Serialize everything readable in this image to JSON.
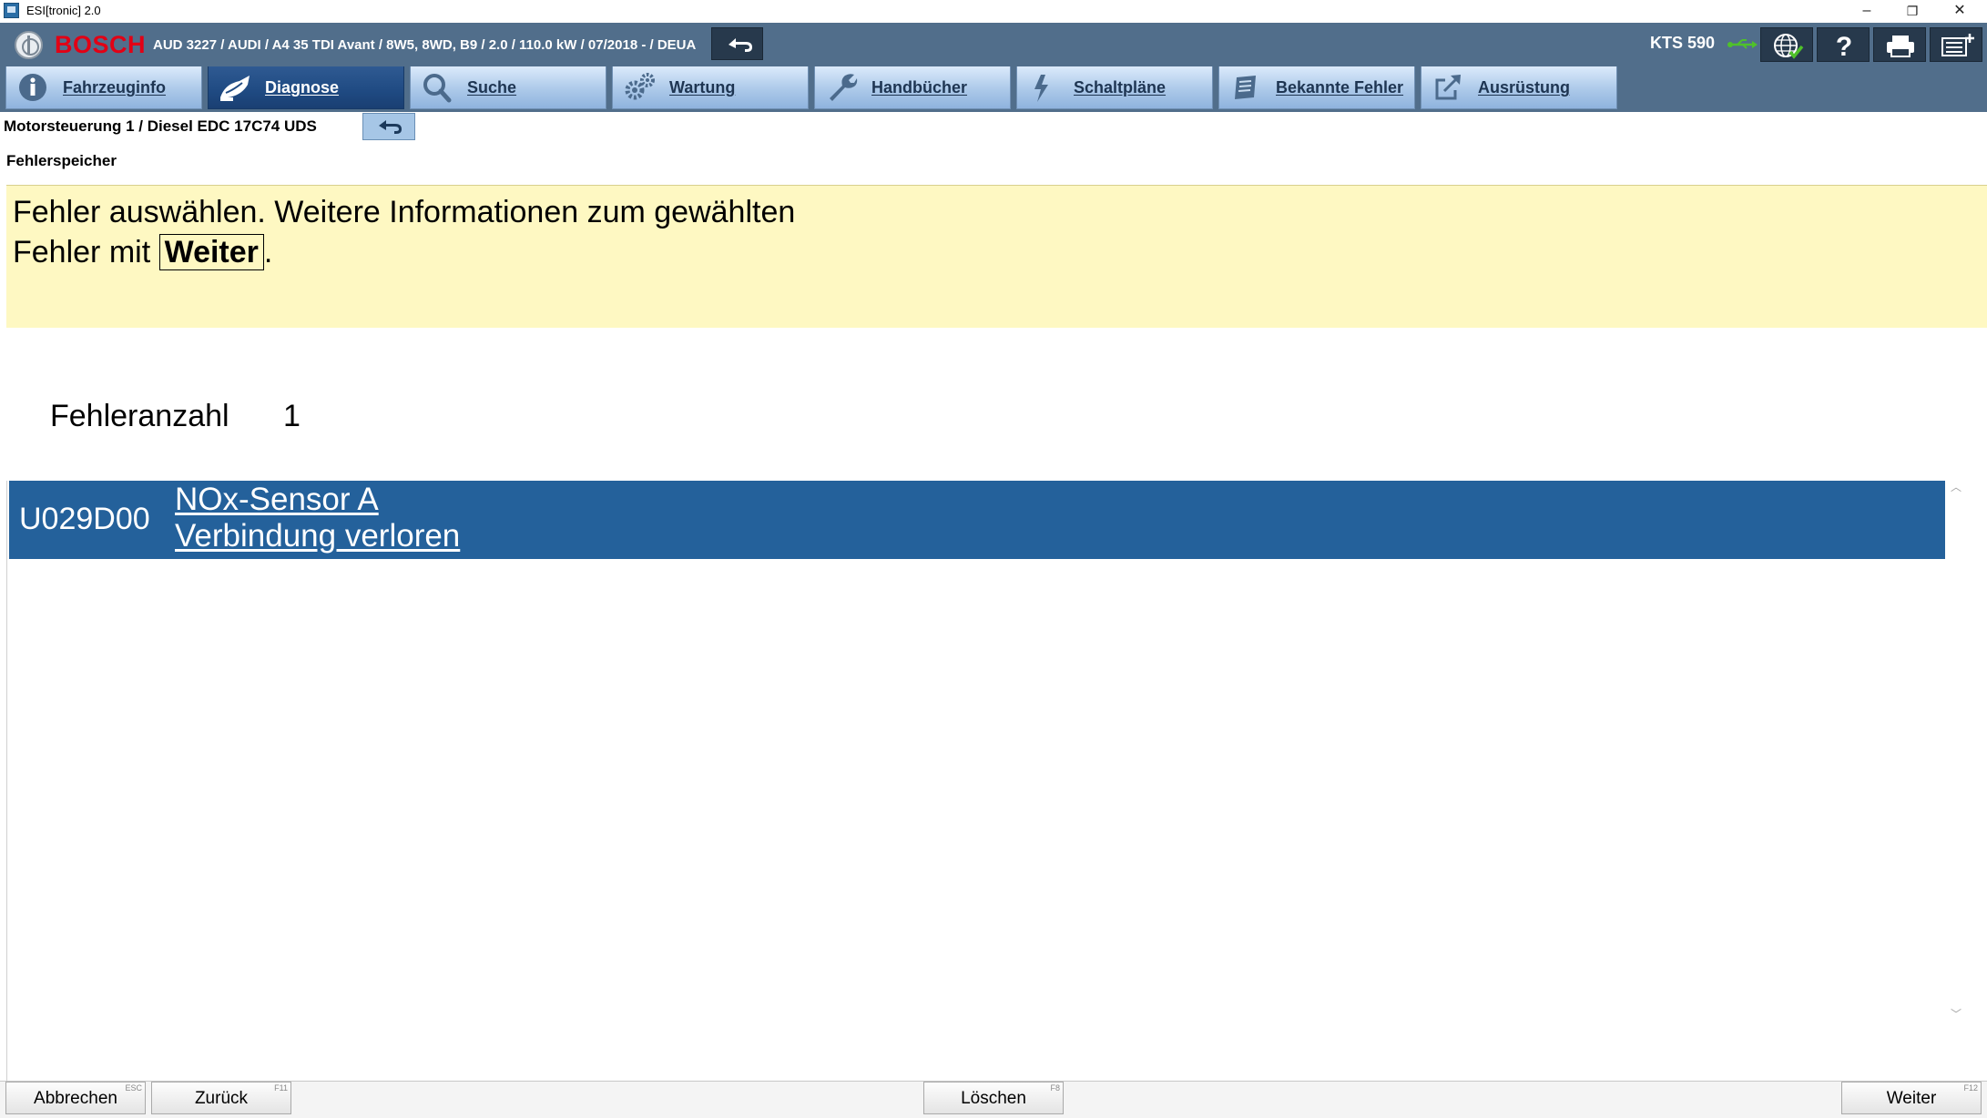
{
  "window": {
    "title": "ESI[tronic] 2.0",
    "minimize_glyph": "–",
    "restore_glyph": "❐",
    "close_glyph": "✕"
  },
  "header": {
    "brand": "BOSCH",
    "vehicle": "AUD 3227 / AUDI / A4 35 TDI Avant / 8W5, 8WD, B9 / 2.0 / 110.0 kW / 07/2018 - / DEUA",
    "device": "KTS 590",
    "icons": [
      "back-arrow-icon",
      "usb-connection-icon",
      "globe-check-icon",
      "help-icon",
      "print-icon",
      "menu-list-icon"
    ]
  },
  "tabs": [
    {
      "label": "Fahrzeuginfo",
      "icon": "info-icon",
      "active": false
    },
    {
      "label": "Diagnose",
      "icon": "diagnose-icon",
      "active": true
    },
    {
      "label": "Suche",
      "icon": "search-icon",
      "active": false
    },
    {
      "label": "Wartung",
      "icon": "gears-icon",
      "active": false
    },
    {
      "label": "Handbücher",
      "icon": "wrench-icon",
      "active": false
    },
    {
      "label": "Schaltpläne",
      "icon": "lightning-icon",
      "active": false
    },
    {
      "label": "Bekannte Fehler",
      "icon": "book-icon",
      "active": false
    },
    {
      "label": "Ausrüstung",
      "icon": "external-link-icon",
      "active": false
    }
  ],
  "breadcrumb": {
    "text": "Motorsteuerung 1 / Diesel EDC 17C74 UDS"
  },
  "section_title": "Fehlerspeicher",
  "instruction": {
    "text_before": "Fehler auswählen. Weitere Informationen zum gewählten Fehler mit ",
    "key": "Weiter",
    "text_after": "."
  },
  "fault_count": {
    "label": "Fehleranzahl",
    "value": "1"
  },
  "faults": [
    {
      "code": "U029D00",
      "line1": "NOx-Sensor A",
      "line2": "Verbindung verloren",
      "selected": true
    }
  ],
  "footer": {
    "abbrechen": {
      "label": "Abbrechen",
      "key": "ESC"
    },
    "zurueck": {
      "label": "Zurück",
      "key": "F11"
    },
    "loeschen": {
      "label": "Löschen",
      "key": "F8"
    },
    "weiter": {
      "label": "Weiter",
      "key": "F12"
    }
  },
  "colors": {
    "header_bg": "#516e8b",
    "brand_red": "#e20015",
    "active_tab": "#1f4a82",
    "instruction_bg": "#fef8c2",
    "selected_row": "#24619b"
  }
}
